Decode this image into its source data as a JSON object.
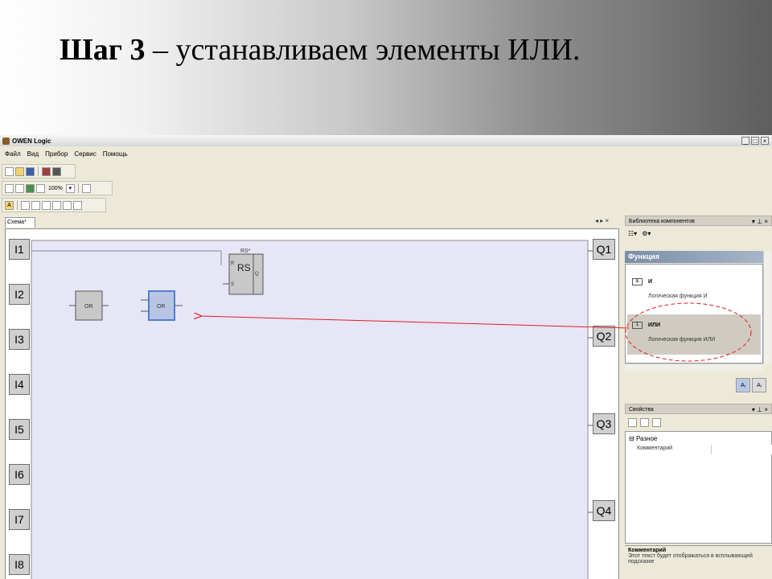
{
  "slide": {
    "title_bold": "Шаг 3",
    "title_rest": " – устанавливаем элементы ИЛИ."
  },
  "window": {
    "title": "OWEN Logic",
    "controls": [
      "_",
      "□",
      "×"
    ]
  },
  "menu": [
    "Файл",
    "Вид",
    "Прибор",
    "Сервис",
    "Помощь"
  ],
  "toolbar2": {
    "zoom": "100%"
  },
  "schema_tab": {
    "label": "Схема*"
  },
  "inputs": [
    "I1",
    "I2",
    "I3",
    "I4",
    "I5",
    "I6",
    "I7",
    "I8"
  ],
  "outputs": [
    "Q1",
    "Q2",
    "Q3",
    "Q4"
  ],
  "blocks": {
    "or1": "OR",
    "or2": "OR",
    "rs_label": "RS",
    "rs_top": "RS*",
    "rs_r": "R",
    "rs_s": "S",
    "rs_q": "Q"
  },
  "library": {
    "header": "Библиотека компонентов",
    "section": "Функция",
    "items": [
      {
        "icon": "&",
        "name": "И",
        "desc": "Логическая функция И"
      },
      {
        "icon": "1",
        "name": "ИЛИ",
        "desc": "Логическая функция ИЛИ"
      }
    ]
  },
  "properties": {
    "header": "Свойства",
    "group": "Разное",
    "row_key": "Комментарий"
  },
  "comment": {
    "title": "Комментарий",
    "text": "Этот текст будет отображаться в всплывающей подсказке"
  },
  "colors": {
    "canvas_bg": "#e6e6f7",
    "selected_block": "#4f7fd0",
    "arrow": "#e02020"
  }
}
